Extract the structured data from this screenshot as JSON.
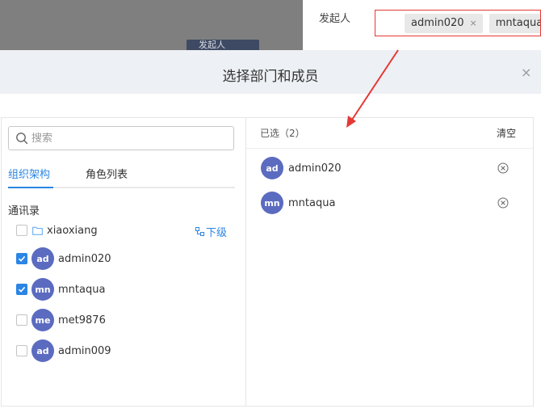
{
  "background": {
    "field_label": "发起人",
    "tags": [
      "admin020",
      "mntaqua"
    ],
    "tag_remove_glyph": "×",
    "button_label": "发起人"
  },
  "dialog": {
    "title": "选择部门和成员",
    "close_glyph": "×"
  },
  "search": {
    "placeholder": "搜索",
    "icon": "search-icon"
  },
  "tabs": [
    {
      "label": "组织架构",
      "active": true
    },
    {
      "label": "角色列表",
      "active": false
    }
  ],
  "tree": {
    "section_title": "通讯录",
    "department": {
      "name": "xiaoxiang",
      "icon": "folder-icon",
      "sub_label": "下级",
      "checked": false
    },
    "members": [
      {
        "initials": "ad",
        "name": "admin020",
        "checked": true
      },
      {
        "initials": "mn",
        "name": "mntaqua",
        "checked": true
      },
      {
        "initials": "me",
        "name": "met9876",
        "checked": false
      },
      {
        "initials": "ad",
        "name": "admin009",
        "checked": false
      }
    ]
  },
  "selected": {
    "header": "已选（2）",
    "clear_label": "清空",
    "items": [
      {
        "initials": "ad",
        "name": "admin020"
      },
      {
        "initials": "mn",
        "name": "mntaqua"
      }
    ]
  },
  "colors": {
    "accent": "#2b85e4",
    "avatar": "#5b6bc0",
    "annotation": "#e53935",
    "overlay": "#7f7f7f",
    "header_bg": "#edf0f4"
  }
}
